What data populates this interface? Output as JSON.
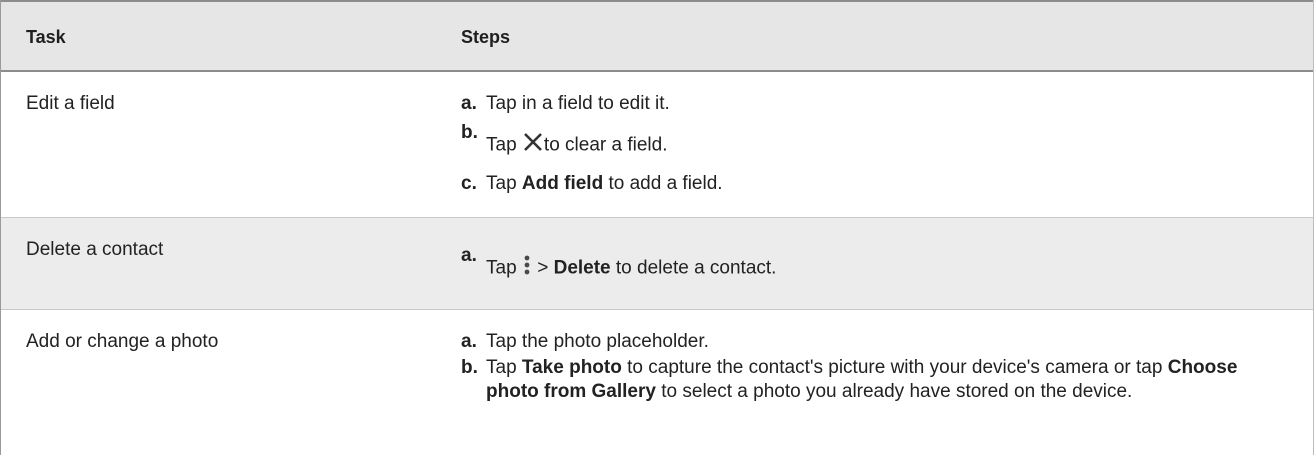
{
  "table": {
    "headers": {
      "task": "Task",
      "steps": "Steps"
    },
    "rows": [
      {
        "task": "Edit a field",
        "steps": [
          {
            "label": "a.",
            "parts": [
              "Tap in a field to edit it."
            ]
          },
          {
            "label": "b.",
            "parts": [
              "Tap",
              "to clear a field."
            ],
            "icon": "close-icon"
          },
          {
            "label": "c.",
            "parts": [
              "Tap",
              "Add field",
              "to add a field."
            ]
          }
        ]
      },
      {
        "task": "Delete a contact",
        "steps": [
          {
            "label": "a.",
            "parts": [
              "Tap",
              ">",
              "Delete",
              "to delete a contact."
            ],
            "icon": "more-vertical-icon"
          }
        ]
      },
      {
        "task": "Add or change a photo",
        "steps": [
          {
            "label": "a.",
            "parts": [
              "Tap the photo placeholder."
            ]
          },
          {
            "label": "b.",
            "parts": [
              "Tap",
              "Take photo",
              "to capture the contact's picture with your device's camera or tap",
              "Choose photo from Gallery",
              "to select a photo you already have stored on the device."
            ]
          }
        ]
      }
    ]
  }
}
